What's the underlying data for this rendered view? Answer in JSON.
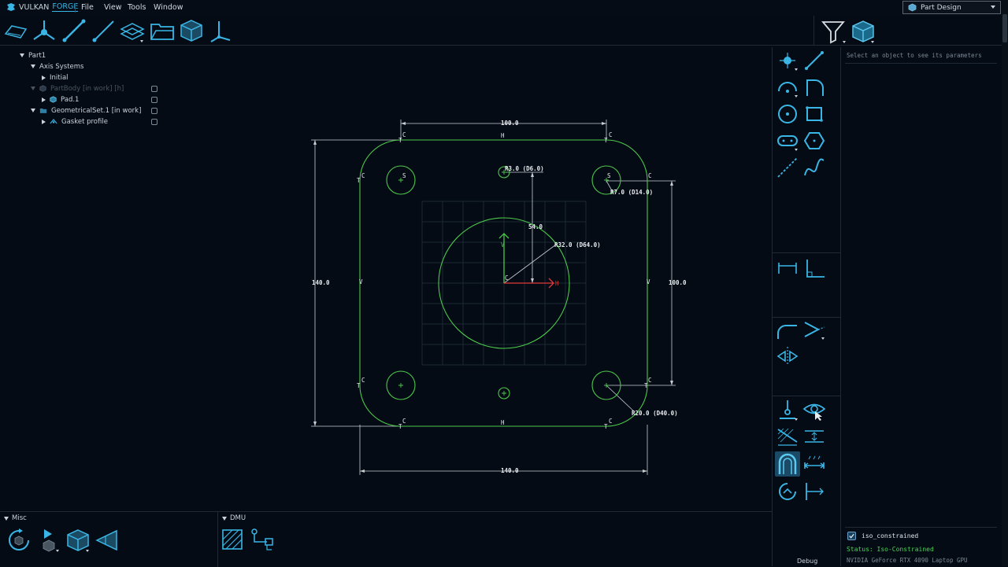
{
  "app": {
    "brand_primary": "VULKAN",
    "brand_accent": "FORGE"
  },
  "menu": {
    "file": "File",
    "view": "View",
    "tools": "Tools",
    "window": "Window"
  },
  "workbench": {
    "selected": "Part Design"
  },
  "tree": {
    "part": "Part1",
    "axis_systems": "Axis Systems",
    "initial": "Initial",
    "partbody": "PartBody  [in work]  [h]",
    "pad": "Pad.1",
    "geomset": "GeometricalSet.1  [in work]",
    "gasket": "Gasket profile"
  },
  "sketch": {
    "dim_top": "100.0",
    "dim_bottom": "140.0",
    "dim_left": "140.0",
    "dim_right": "100.0",
    "dim_v_offset": "54.0",
    "r_small": "R3.0  (D6.0)",
    "r_corner_hole": "R7.0  (D14.0)",
    "r_center": "R32.0  (D64.0)",
    "r_fillet": "R20.0  (D40.0)",
    "axis_v": "V",
    "axis_h": "H",
    "lbl_c": "C",
    "lbl_h": "H",
    "lbl_v": "V",
    "lbl_s": "S",
    "lbl_t": "T"
  },
  "params": {
    "hint": "Select an object to see its parameters",
    "checkbox_label": "iso_constrained",
    "status": "Status: Iso-Constrained",
    "gpu": "NVIDIA GeForce RTX 4090 Laptop GPU"
  },
  "panels": {
    "misc": "Misc",
    "dmu": "DMU",
    "debug": "Debug"
  },
  "colors": {
    "accent": "#3ab6e6",
    "sketch_green": "#4cc84c",
    "dim_white": "#d8dde2",
    "status_green": "#4cd45a",
    "axis_red": "#e03a3a"
  }
}
